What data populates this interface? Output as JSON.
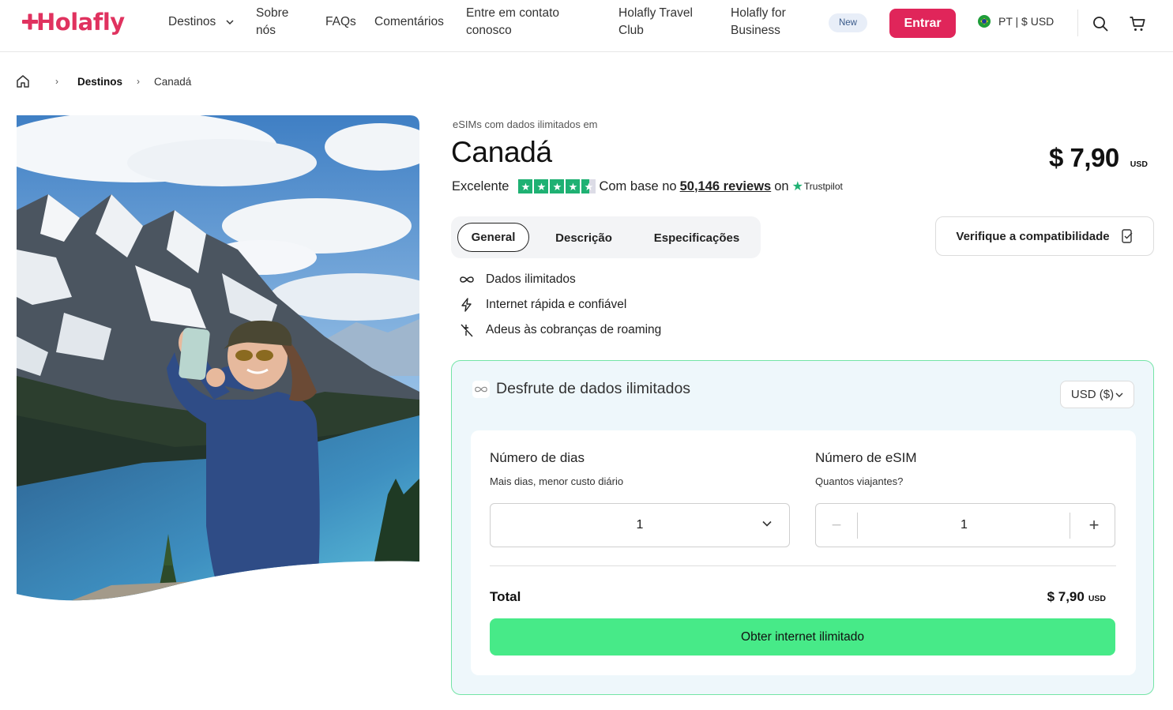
{
  "header": {
    "logo_text": "Holafly",
    "brand_color": "#e0325f",
    "nav": [
      {
        "label": "Destinos"
      },
      {
        "label": "Sobre\nnós"
      },
      {
        "label": "FAQs"
      },
      {
        "label": "Comentários"
      },
      {
        "label": "Entre em contato\nconosco"
      },
      {
        "label": "Holafly Travel\nClub"
      },
      {
        "label": "Holafly for\nBusiness"
      }
    ],
    "new_badge": "New",
    "login_label": "Entrar",
    "login_color": "#e0255a",
    "language_currency": "PT | $ USD",
    "icons": [
      "search-icon",
      "cart-icon"
    ]
  },
  "breadcrumb": {
    "home_icon": "home-icon",
    "items": [
      "Destinos",
      "Canadá"
    ]
  },
  "hero": {
    "image_description": "woman-taking-selfie-mountain-lake-canada"
  },
  "product": {
    "eyebrow": "eSIMs com dados ilimitados em",
    "title": "Canadá",
    "price": "$ 7,90",
    "price_currency": "USD",
    "rating_label": "Excelente",
    "stars": 4.5,
    "based_on": "Com base no",
    "reviews_link": "50,146 reviews",
    "on": "on",
    "trustpilot": "Trustpilot",
    "trustpilot_color": "#1fb173"
  },
  "tabs": [
    {
      "label": "General",
      "active": true
    },
    {
      "label": "Descrição",
      "active": false
    },
    {
      "label": "Especificações",
      "active": false
    }
  ],
  "compatibility_button": "Verifique a compatibilidade",
  "features": [
    {
      "icon": "infinity-icon",
      "text": "Dados ilimitados"
    },
    {
      "icon": "lightning-icon",
      "text": "Internet rápida e confiável"
    },
    {
      "icon": "no-roaming-icon",
      "text": "Adeus às cobranças de roaming"
    }
  ],
  "purchase": {
    "heading": "Desfrute de dados ilimitados",
    "currency_select": "USD ($)",
    "days_label": "Número de dias",
    "days_help": "Mais dias, menor custo diário",
    "days_value": "1",
    "esim_label": "Número de eSIM",
    "esim_help": "Quantos viajantes?",
    "esim_value": "1",
    "minus": "−",
    "plus": "+",
    "total_label": "Total",
    "total_value": "$ 7,90",
    "total_currency": "USD",
    "cta_label": "Obter internet ilimitado",
    "cta_color": "#47ea88",
    "border_color": "#74e4a6"
  }
}
